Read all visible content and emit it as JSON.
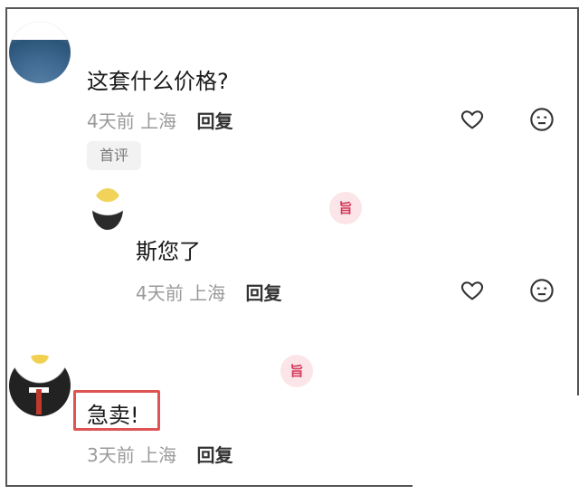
{
  "comment1": {
    "text": "这套什么价格?",
    "time": "4天前",
    "location": "上海",
    "reply_label": "回复",
    "tag": "首评",
    "like_icon": "heart-outline-icon",
    "react_icon": "neutral-face-icon"
  },
  "reply1": {
    "text": "斯您了",
    "time": "4天前",
    "location": "上海",
    "reply_label": "回复",
    "badge": "旨"
  },
  "comment2": {
    "text": "急卖!",
    "time": "3天前",
    "location": "上海",
    "reply_label": "回复",
    "badge": "旨"
  },
  "colors": {
    "highlight": "#e05353",
    "badge_bg": "#fbe5e9",
    "badge_text": "#d23a5a"
  }
}
